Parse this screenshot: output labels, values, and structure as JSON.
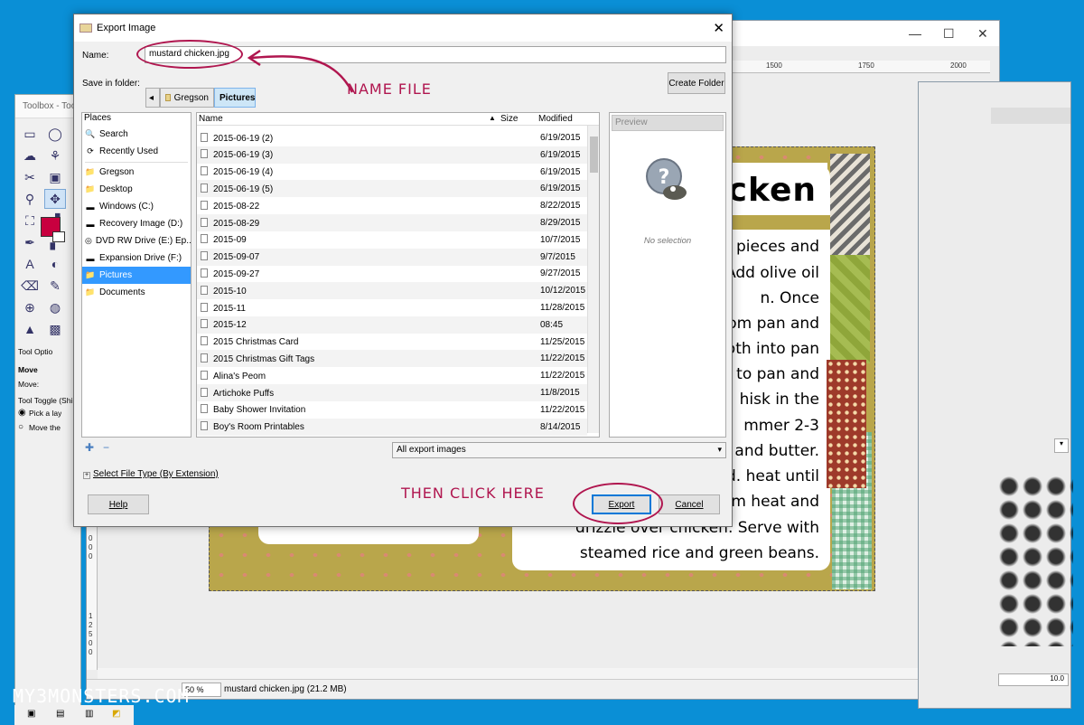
{
  "toolbox": {
    "title": "Toolbox - Too",
    "tools": [
      "▭",
      "◯",
      "☁",
      "⚘",
      "✂",
      "▣",
      "⚲",
      "✥",
      "⛶",
      "▟",
      "✒",
      "▞",
      "A",
      "◐",
      "⌫",
      "✎",
      "⊕",
      "◍",
      "▲",
      "▩"
    ],
    "tool_options_title": "Tool Optio",
    "move_label": "Move",
    "move_field_label": "Move:",
    "tool_toggle_label": "Tool Toggle  (Shi",
    "option_1": "Pick a lay",
    "option_2": "Move the"
  },
  "image_window": {
    "ruler_labels": [
      "1500",
      "1750",
      "2000"
    ],
    "ruler_v_labels": [
      "0",
      "0",
      "0",
      "1",
      "2",
      "5",
      "0",
      "0"
    ],
    "zoom": "50 %",
    "status_file": "mustard chicken.jpg (21.2 MB)"
  },
  "canvas": {
    "title": "cken",
    "lines": [
      "pieces and",
      "Add olive oil",
      "n.  Once",
      "rom pan and",
      "roth into pan",
      "to pan and",
      "hisk in the",
      "mmer 2-3",
      "and butter.",
      "d. heat until",
      "m heat and",
      "drizzle over chicken.  Serve with",
      "steamed rice and green beans."
    ]
  },
  "dialog": {
    "title": "Export Image",
    "name_label": "Name:",
    "name_value": "mustard chicken.jpg",
    "save_in_label": "Save in folder:",
    "crumbs": [
      "Gregson",
      "Pictures"
    ],
    "create_folder": "Create Folder",
    "places_header": "Places",
    "places": [
      {
        "icon": "🔍",
        "label": "Search"
      },
      {
        "icon": "⟳",
        "label": "Recently Used"
      },
      {
        "icon": "📁",
        "label": "Gregson"
      },
      {
        "icon": "📁",
        "label": "Desktop"
      },
      {
        "icon": "▬",
        "label": "Windows (C:)"
      },
      {
        "icon": "▬",
        "label": "Recovery Image (D:)"
      },
      {
        "icon": "◎",
        "label": "DVD RW Drive (E:) Ep..."
      },
      {
        "icon": "▬",
        "label": "Expansion Drive (F:)"
      },
      {
        "icon": "📁",
        "label": "Pictures"
      },
      {
        "icon": "📁",
        "label": "Documents"
      }
    ],
    "columns": {
      "name": "Name",
      "size": "Size",
      "modified": "Modified"
    },
    "files": [
      {
        "name": "2015-06-19 (2)",
        "modified": "6/19/2015"
      },
      {
        "name": "2015-06-19 (3)",
        "modified": "6/19/2015"
      },
      {
        "name": "2015-06-19 (4)",
        "modified": "6/19/2015"
      },
      {
        "name": "2015-06-19 (5)",
        "modified": "6/19/2015"
      },
      {
        "name": "2015-08-22",
        "modified": "8/22/2015"
      },
      {
        "name": "2015-08-29",
        "modified": "8/29/2015"
      },
      {
        "name": "2015-09",
        "modified": "10/7/2015"
      },
      {
        "name": "2015-09-07",
        "modified": "9/7/2015"
      },
      {
        "name": "2015-09-27",
        "modified": "9/27/2015"
      },
      {
        "name": "2015-10",
        "modified": "10/12/2015"
      },
      {
        "name": "2015-11",
        "modified": "11/28/2015"
      },
      {
        "name": "2015-12",
        "modified": "08:45"
      },
      {
        "name": "2015 Christmas Card",
        "modified": "11/25/2015"
      },
      {
        "name": "2015 Christmas Gift Tags",
        "modified": "11/22/2015"
      },
      {
        "name": "Alina's Peom",
        "modified": "11/22/2015"
      },
      {
        "name": "Artichoke Puffs",
        "modified": "11/8/2015"
      },
      {
        "name": "Baby Shower Invitation",
        "modified": "11/22/2015"
      },
      {
        "name": "Boy's Room Printables",
        "modified": "8/14/2015"
      }
    ],
    "preview_label": "Preview",
    "no_selection": "No selection",
    "filter_value": "All export images",
    "select_file_type": "Select File Type (By Extension)",
    "help": "Help",
    "export": "Export",
    "cancel": "Cancel"
  },
  "annotations": {
    "name_file": "NAME FILE",
    "then_click": "THEN CLICK HERE"
  },
  "watermark": "MY3MONSTERS.COM",
  "colors": {
    "accent": "#b0164f",
    "desktop": "#0a8fd6",
    "selection": "#3399ff"
  }
}
